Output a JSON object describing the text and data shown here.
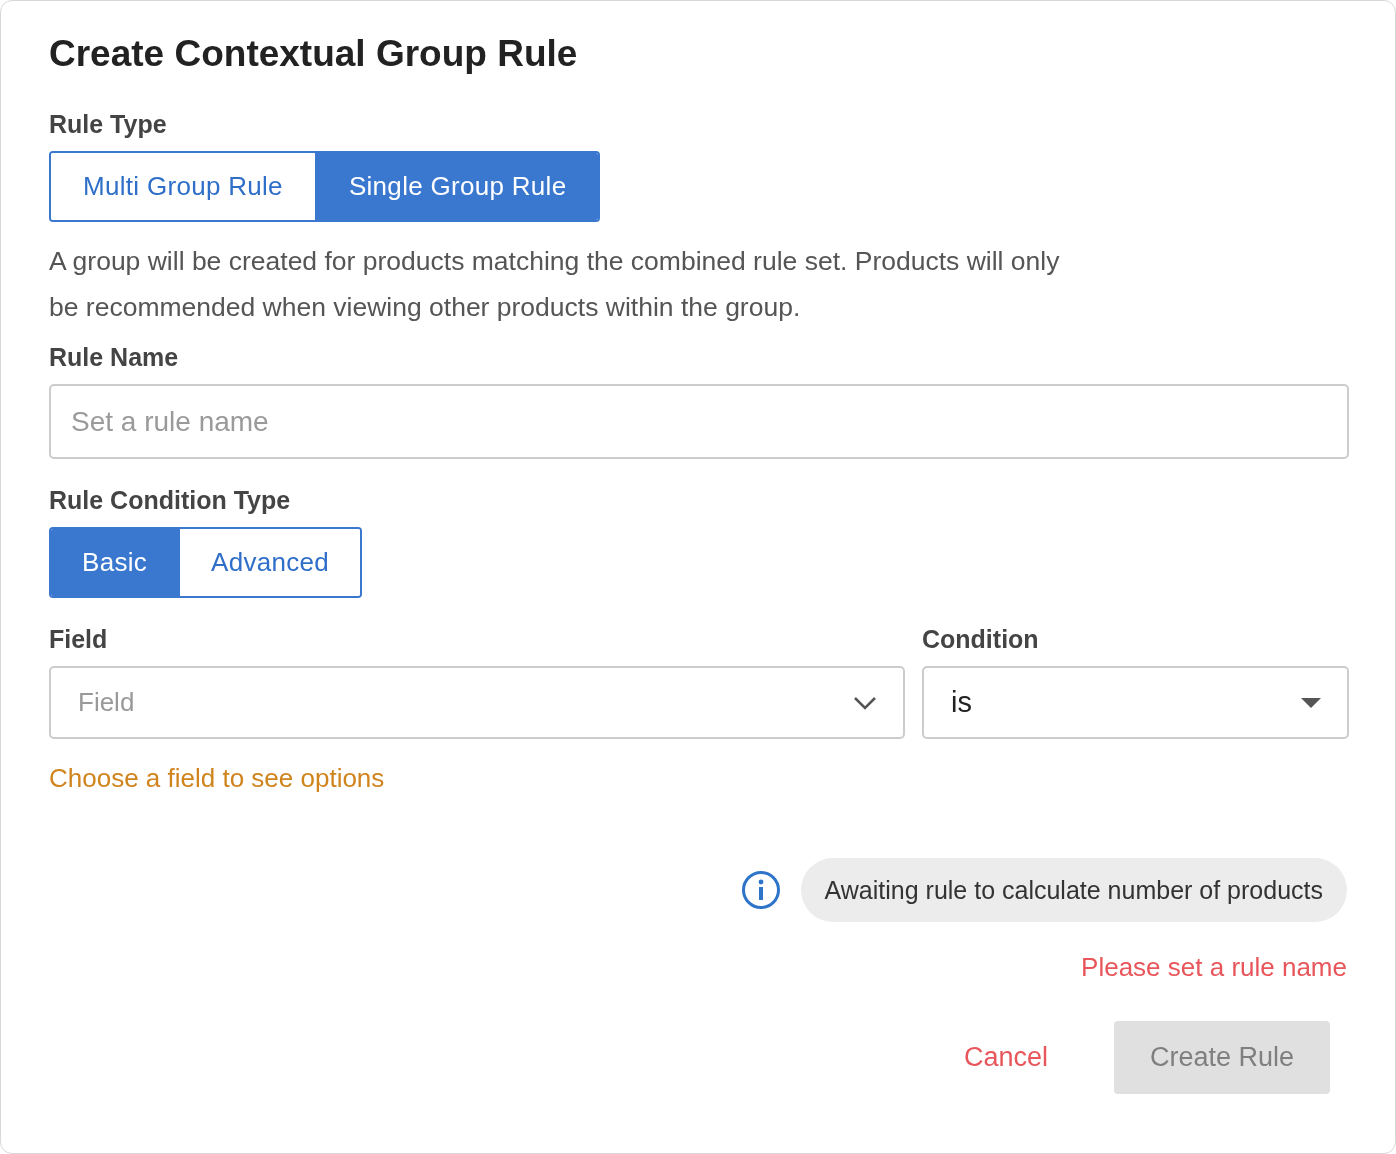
{
  "dialog": {
    "title": "Create Contextual Group Rule"
  },
  "rule_type": {
    "label": "Rule Type",
    "options": [
      {
        "label": "Multi Group Rule",
        "selected": false
      },
      {
        "label": "Single Group Rule",
        "selected": true
      }
    ]
  },
  "description": "A group will be created for products matching the combined rule set. Products will only be recommended when viewing other products within the group.",
  "rule_name": {
    "label": "Rule Name",
    "placeholder": "Set a rule name"
  },
  "condition_type": {
    "label": "Rule Condition Type",
    "options": [
      {
        "label": "Basic",
        "selected": true
      },
      {
        "label": "Advanced",
        "selected": false
      }
    ]
  },
  "field": {
    "label": "Field",
    "placeholder": "Field"
  },
  "condition": {
    "label": "Condition",
    "value": "is"
  },
  "field_hint": "Choose a field to see options",
  "status": {
    "text": "Awaiting rule to calculate number of products"
  },
  "error": "Please set a rule name",
  "buttons": [
    {
      "kind": "text",
      "label": "Cancel",
      "disabled": false
    },
    {
      "kind": "primary",
      "label": "Create Rule",
      "disabled": true
    }
  ]
}
